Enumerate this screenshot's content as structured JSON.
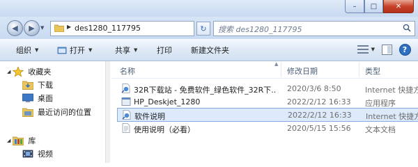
{
  "window": {
    "minimize_glyph": "–",
    "maximize_glyph": "□",
    "close_glyph": "✕"
  },
  "address": {
    "path": "des1280_117795",
    "separator": "▶",
    "refresh_glyph": "↻"
  },
  "search": {
    "placeholder": "搜索 des1280_117795"
  },
  "toolbar": {
    "organize": "组织",
    "open": "打开",
    "share": "共享",
    "print": "打印",
    "new_folder": "新建文件夹",
    "help": "?"
  },
  "sidebar": {
    "items": [
      {
        "label": "收藏夹",
        "icon": "star-icon"
      },
      {
        "label": "下载",
        "icon": "download-folder-icon"
      },
      {
        "label": "桌面",
        "icon": "desktop-icon"
      },
      {
        "label": "最近访问的位置",
        "icon": "recent-places-icon"
      },
      {
        "label": "库",
        "icon": "libraries-icon"
      },
      {
        "label": "视频",
        "icon": "video-library-icon"
      }
    ]
  },
  "columns": {
    "name": "名称",
    "modified": "修改日期",
    "type": "类型"
  },
  "files": [
    {
      "name": "32R下载站 - 免费软件_绿色软件_32R下...",
      "date": "2020/3/6 8:50",
      "type": "Internet 快捷方",
      "icon": "internet-shortcut-icon"
    },
    {
      "name": "HP_Deskjet_1280",
      "date": "2022/2/12 16:33",
      "type": "应用程序",
      "icon": "application-icon"
    },
    {
      "name": "软件说明",
      "date": "2022/2/12 16:33",
      "type": "Internet 快捷方",
      "icon": "internet-shortcut-icon"
    },
    {
      "name": "使用说明（必看）",
      "date": "2020/5/15 15:56",
      "type": "文本文档",
      "icon": "text-document-icon"
    }
  ],
  "colors": {
    "accent": "#2d6fc2",
    "selection": "#dceafc",
    "selection_border": "#84acdd"
  }
}
